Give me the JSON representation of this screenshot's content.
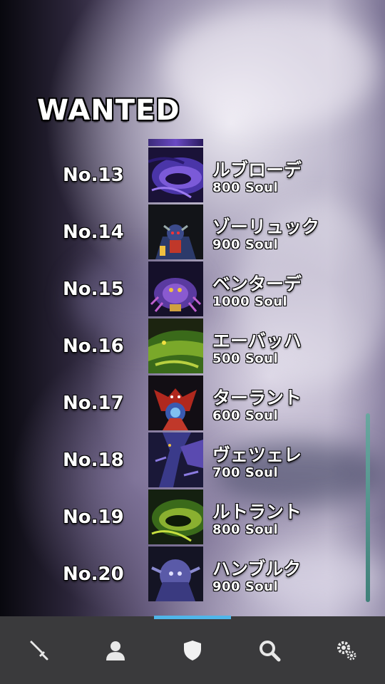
{
  "title": "WANTED",
  "wanted": [
    {
      "no": "No.13",
      "name": "ルブローデ",
      "soul": "800 Soul",
      "art": "eye-purple"
    },
    {
      "no": "No.14",
      "name": "ゾーリュック",
      "soul": "900 Soul",
      "art": "knight-red"
    },
    {
      "no": "No.15",
      "name": "ベンターデ",
      "soul": "1000 Soul",
      "art": "crab-purple"
    },
    {
      "no": "No.16",
      "name": "エーバッハ",
      "soul": "500 Soul",
      "art": "dragon-green"
    },
    {
      "no": "No.17",
      "name": "ターラント",
      "soul": "600 Soul",
      "art": "demon-red"
    },
    {
      "no": "No.18",
      "name": "ヴェツェレ",
      "soul": "700 Soul",
      "art": "dragon-blue"
    },
    {
      "no": "No.19",
      "name": "ルトラント",
      "soul": "800 Soul",
      "art": "eye-green"
    },
    {
      "no": "No.20",
      "name": "ハンブルク",
      "soul": "900 Soul",
      "art": "golem-blue"
    }
  ],
  "nav": [
    {
      "id": "battle",
      "icon": "sword-icon"
    },
    {
      "id": "character",
      "icon": "person-icon"
    },
    {
      "id": "wanted",
      "icon": "shield-icon",
      "active": true
    },
    {
      "id": "search",
      "icon": "magnifier-icon"
    },
    {
      "id": "settings",
      "icon": "gears-icon"
    }
  ],
  "colors": {
    "accent": "#4fb6ea",
    "navbar": "#3a3a3c",
    "scrollbar": "#4f918a"
  }
}
